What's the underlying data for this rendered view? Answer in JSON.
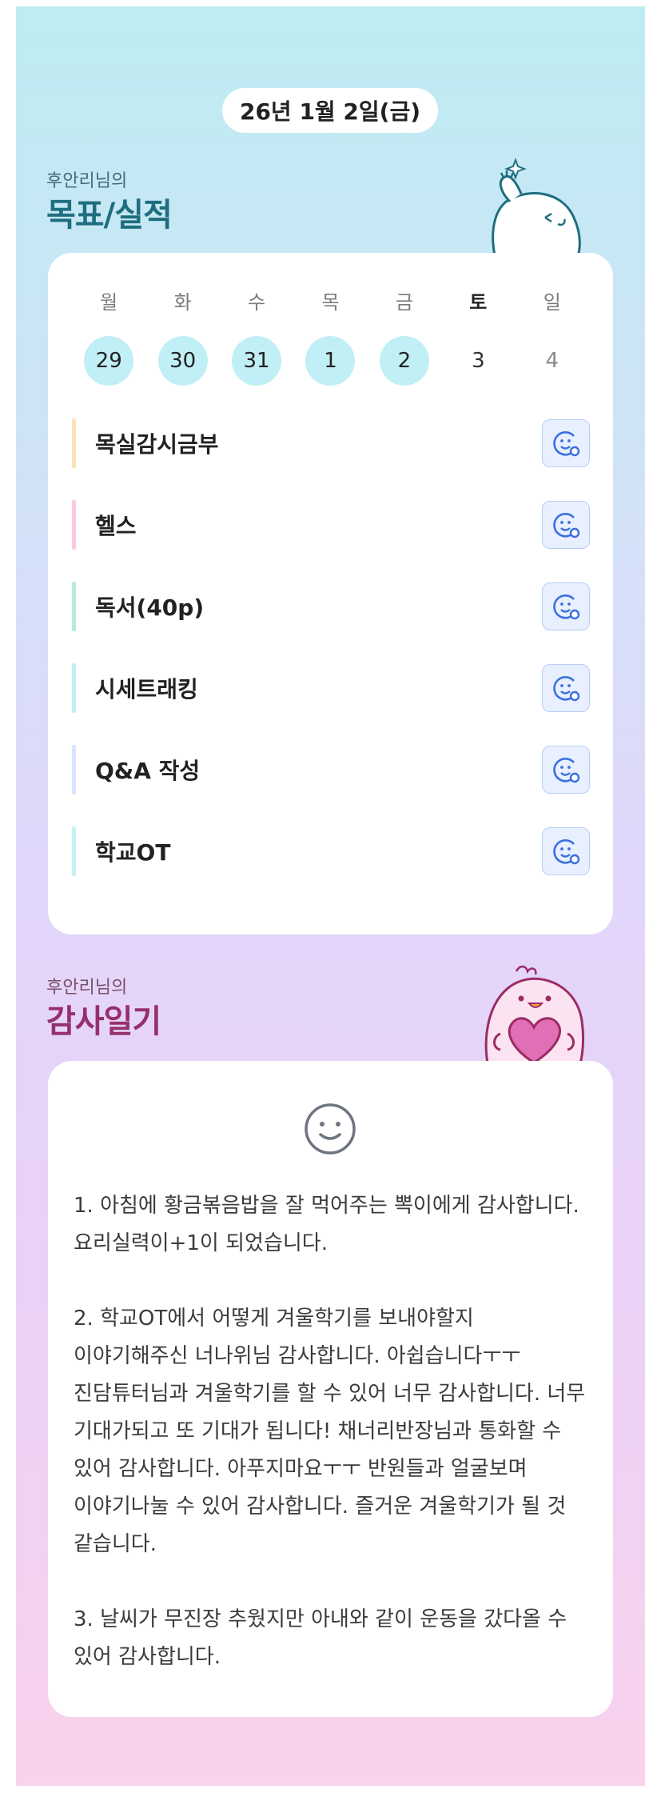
{
  "header": {
    "date": "26년 1월 2일(금)"
  },
  "goals_section": {
    "owner_label": "후안리님의",
    "title": "목표/실적"
  },
  "calendar": {
    "weekdays": [
      "월",
      "화",
      "수",
      "목",
      "금",
      "토",
      "일"
    ],
    "days": [
      {
        "num": "29",
        "state": "done"
      },
      {
        "num": "30",
        "state": "done"
      },
      {
        "num": "31",
        "state": "done"
      },
      {
        "num": "1",
        "state": "done"
      },
      {
        "num": "2",
        "state": "done"
      },
      {
        "num": "3",
        "state": "today"
      },
      {
        "num": "4",
        "state": "future"
      }
    ]
  },
  "goals": [
    {
      "label": "목실감시금부",
      "color": "#fbe2b5",
      "icon": "smile-check-icon"
    },
    {
      "label": "헬스",
      "color": "#fbc9e6",
      "icon": "smile-check-icon"
    },
    {
      "label": "독서(40p)",
      "color": "#b9ecd6",
      "icon": "smile-check-icon"
    },
    {
      "label": "시세트래킹",
      "color": "#bff0f3",
      "icon": "smile-check-icon"
    },
    {
      "label": "Q&A 작성",
      "color": "#d9e4fd",
      "icon": "smile-check-icon"
    },
    {
      "label": "학교OT",
      "color": "#c7f1f5",
      "icon": "smile-check-icon"
    }
  ],
  "gratitude_section": {
    "owner_label": "후안리님의",
    "title": "감사일기"
  },
  "diary": {
    "mood_icon": "smile-icon",
    "text": "1. 아침에 황금볶음밥을 잘 먹어주는 뽁이에게 감사합니다. 요리실력이+1이 되었습니다.\n\n2. 학교OT에서 어떻게 겨울학기를 보내야할지 이야기해주신 너나위님 감사합니다. 아쉽습니다ㅜㅜ 진담튜터님과 겨울학기를 할 수 있어 너무 감사합니다. 너무 기대가되고 또 기대가 됩니다! 채너리반장님과 통화할 수 있어 감사합니다. 아푸지마요ㅜㅜ 반원들과 얼굴보며 이야기나눌 수 있어 감사합니다. 즐거운 겨울학기가 될 것 같습니다.\n\n3. 날씨가 무진장 추웠지만 아내와 같이 운동을 갔다올 수 있어 감사합니다."
  },
  "colors": {
    "accent_teal": "#1f6e80",
    "accent_magenta": "#96306b",
    "done_day": "#c0eff5",
    "icon_blue": "#3b6fe0"
  }
}
